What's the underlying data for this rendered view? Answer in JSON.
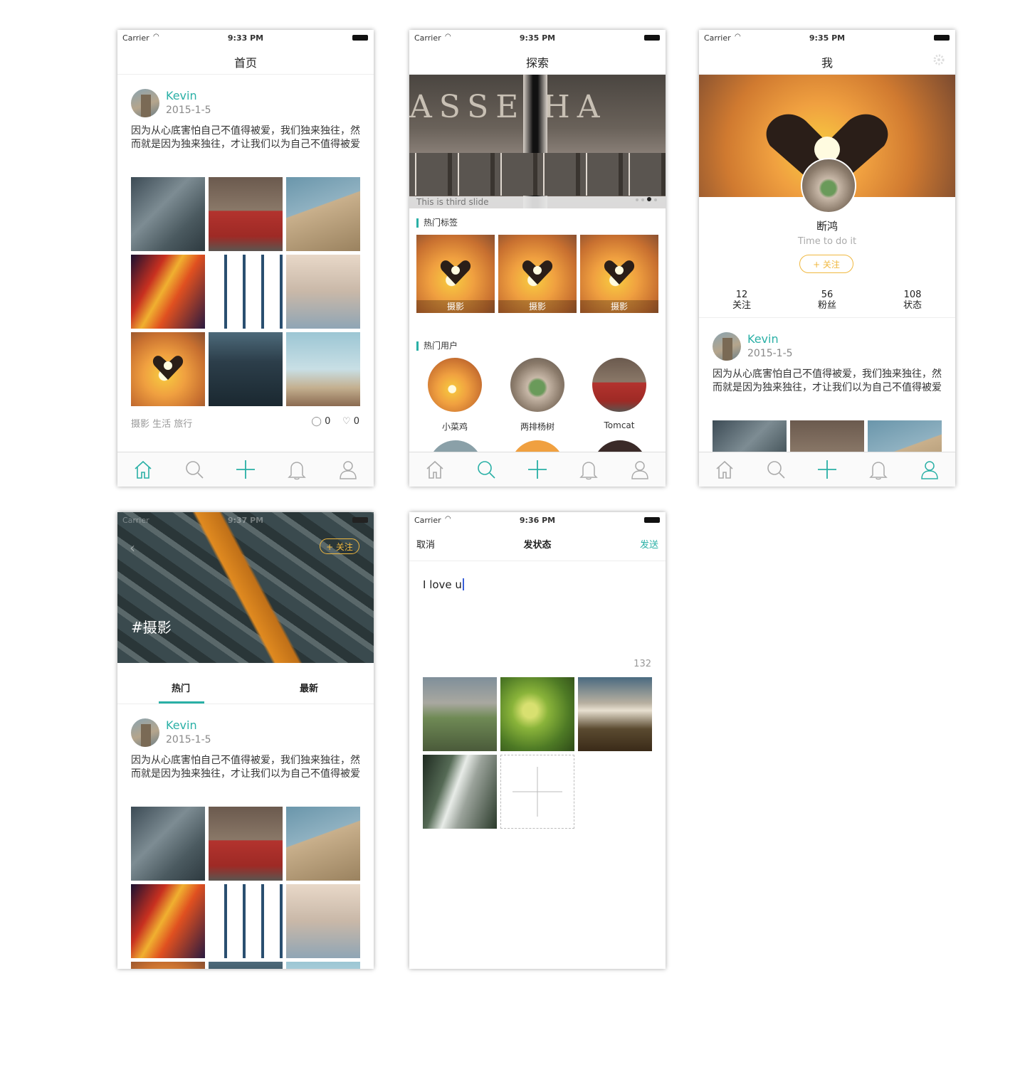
{
  "status": {
    "carrier": "Carrier",
    "t1": "9:33 PM",
    "t2": "9:35 PM",
    "t3": "9:35 PM",
    "t4": "9:37 PM",
    "t5": "9:36 PM"
  },
  "home": {
    "title": "首页"
  },
  "post": {
    "username": "Kevin",
    "date": "2015-1-5",
    "text": "因为从心底害怕自己不值得被爱，我们独来独往，然而就是因为独来独往，才让我们以为自己不值得被爱",
    "tags": "摄影 生活 旅行",
    "comments": "0",
    "likes": "0"
  },
  "explore": {
    "title": "探索",
    "slide_caption": "This is third slide",
    "hot_tags_title": "热门标签",
    "tags": [
      "摄影",
      "摄影",
      "摄影"
    ],
    "hot_users_title": "热门用户",
    "users": [
      "小菜鸡",
      "两排杨树",
      "Tomcat"
    ]
  },
  "me": {
    "title": "我",
    "name": "断鸿",
    "bio": "Time to do it",
    "follow_btn": "+ 关注",
    "stats": [
      {
        "num": "12",
        "label": "关注"
      },
      {
        "num": "56",
        "label": "粉丝"
      },
      {
        "num": "108",
        "label": "状态"
      }
    ]
  },
  "topic": {
    "hashtag": "#摄影",
    "follow_btn": "+ 关注",
    "tab_hot": "热门",
    "tab_new": "最新"
  },
  "compose": {
    "cancel": "取消",
    "title": "发状态",
    "send": "发送",
    "text": "I love u",
    "remaining": "132"
  },
  "colors": {
    "accent": "#2ab0a6",
    "follow": "#f0b840"
  }
}
